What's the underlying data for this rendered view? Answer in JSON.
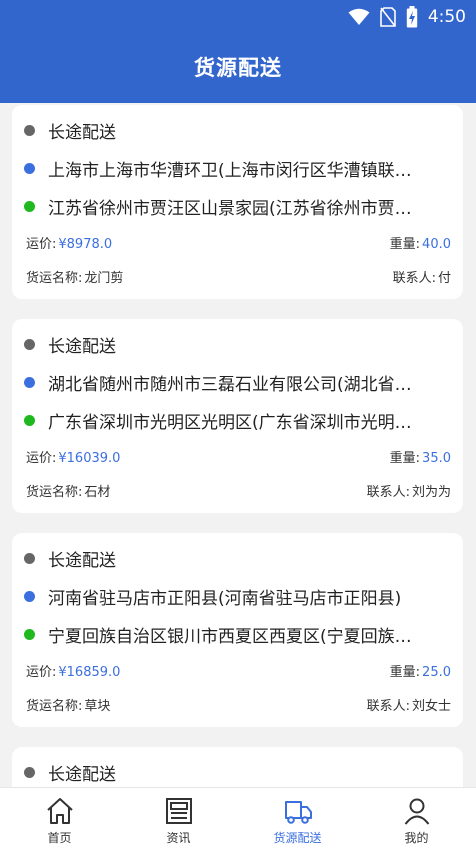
{
  "status_bar": {
    "time": "4:50",
    "icons": [
      "wifi-icon",
      "no-sim-icon",
      "battery-charging-icon"
    ]
  },
  "header": {
    "title": "货源配送"
  },
  "shipments": [
    {
      "type": "长途配送",
      "origin": "上海市上海市华漕环卫(上海市闵行区华漕镇联…",
      "destination": "江苏省徐州市贾汪区山景家园(江苏省徐州市贾…",
      "price_label": "运价:",
      "price": "¥8978.0",
      "weight_label": "重量:",
      "weight": "40.0",
      "goods_label": "货运名称:",
      "goods": "龙门剪",
      "contact_label": "联系人:",
      "contact": "付"
    },
    {
      "type": "长途配送",
      "origin": "湖北省随州市随州市三磊石业有限公司(湖北省…",
      "destination": "广东省深圳市光明区光明区(广东省深圳市光明…",
      "price_label": "运价:",
      "price": "¥16039.0",
      "weight_label": "重量:",
      "weight": "35.0",
      "goods_label": "货运名称:",
      "goods": "石材",
      "contact_label": "联系人:",
      "contact": "刘为为"
    },
    {
      "type": "长途配送",
      "origin": "河南省驻马店市正阳县(河南省驻马店市正阳县)",
      "destination": "宁夏回族自治区银川市西夏区西夏区(宁夏回族…",
      "price_label": "运价:",
      "price": "¥16859.0",
      "weight_label": "重量:",
      "weight": "25.0",
      "goods_label": "货运名称:",
      "goods": "草块",
      "contact_label": "联系人:",
      "contact": "刘女士"
    },
    {
      "type": "长途配送"
    }
  ],
  "tabs": [
    {
      "label": "首页",
      "icon": "home-icon"
    },
    {
      "label": "资讯",
      "icon": "news-icon"
    },
    {
      "label": "货源配送",
      "icon": "truck-icon",
      "active": true
    },
    {
      "label": "我的",
      "icon": "user-icon"
    }
  ],
  "colors": {
    "primary": "#3366cc",
    "accent": "#3b6fe0",
    "origin_dot": "#3b6fe0",
    "destination_dot": "#1fb81f",
    "type_dot": "#666666"
  }
}
